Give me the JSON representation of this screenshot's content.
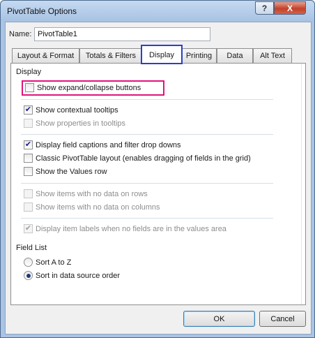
{
  "window": {
    "title": "PivotTable Options",
    "help_label": "?",
    "close_label": "X"
  },
  "name_field": {
    "label": "Name:",
    "value": "PivotTable1"
  },
  "tabs": [
    {
      "label": "Layout & Format"
    },
    {
      "label": "Totals & Filters"
    },
    {
      "label": "Display",
      "active": true
    },
    {
      "label": "Printing"
    },
    {
      "label": "Data"
    },
    {
      "label": "Alt Text"
    }
  ],
  "display_section": {
    "label": "Display",
    "options": [
      {
        "label": "Show expand/collapse buttons",
        "checked": false,
        "enabled": true,
        "highlighted": true
      },
      {
        "label": "Show contextual tooltips",
        "checked": true,
        "enabled": true
      },
      {
        "label": "Show properties in tooltips",
        "checked": false,
        "enabled": false
      },
      {
        "label": "Display field captions and filter drop downs",
        "checked": true,
        "enabled": true
      },
      {
        "label": "Classic PivotTable layout (enables dragging of fields in the grid)",
        "checked": false,
        "enabled": true
      },
      {
        "label": "Show the Values row",
        "checked": false,
        "enabled": true
      },
      {
        "label": "Show items with no data on rows",
        "checked": false,
        "enabled": false
      },
      {
        "label": "Show items with no data on columns",
        "checked": false,
        "enabled": false
      },
      {
        "label": "Display item labels when no fields are in the values area",
        "checked": true,
        "enabled": false
      }
    ]
  },
  "field_list_section": {
    "label": "Field List",
    "options": [
      {
        "label": "Sort A to Z",
        "selected": false
      },
      {
        "label": "Sort in data source order",
        "selected": true
      }
    ]
  },
  "buttons": {
    "ok": "OK",
    "cancel": "Cancel"
  },
  "colors": {
    "highlight_box": "#e2127d",
    "active_tab_outline": "#2a3fc7"
  }
}
